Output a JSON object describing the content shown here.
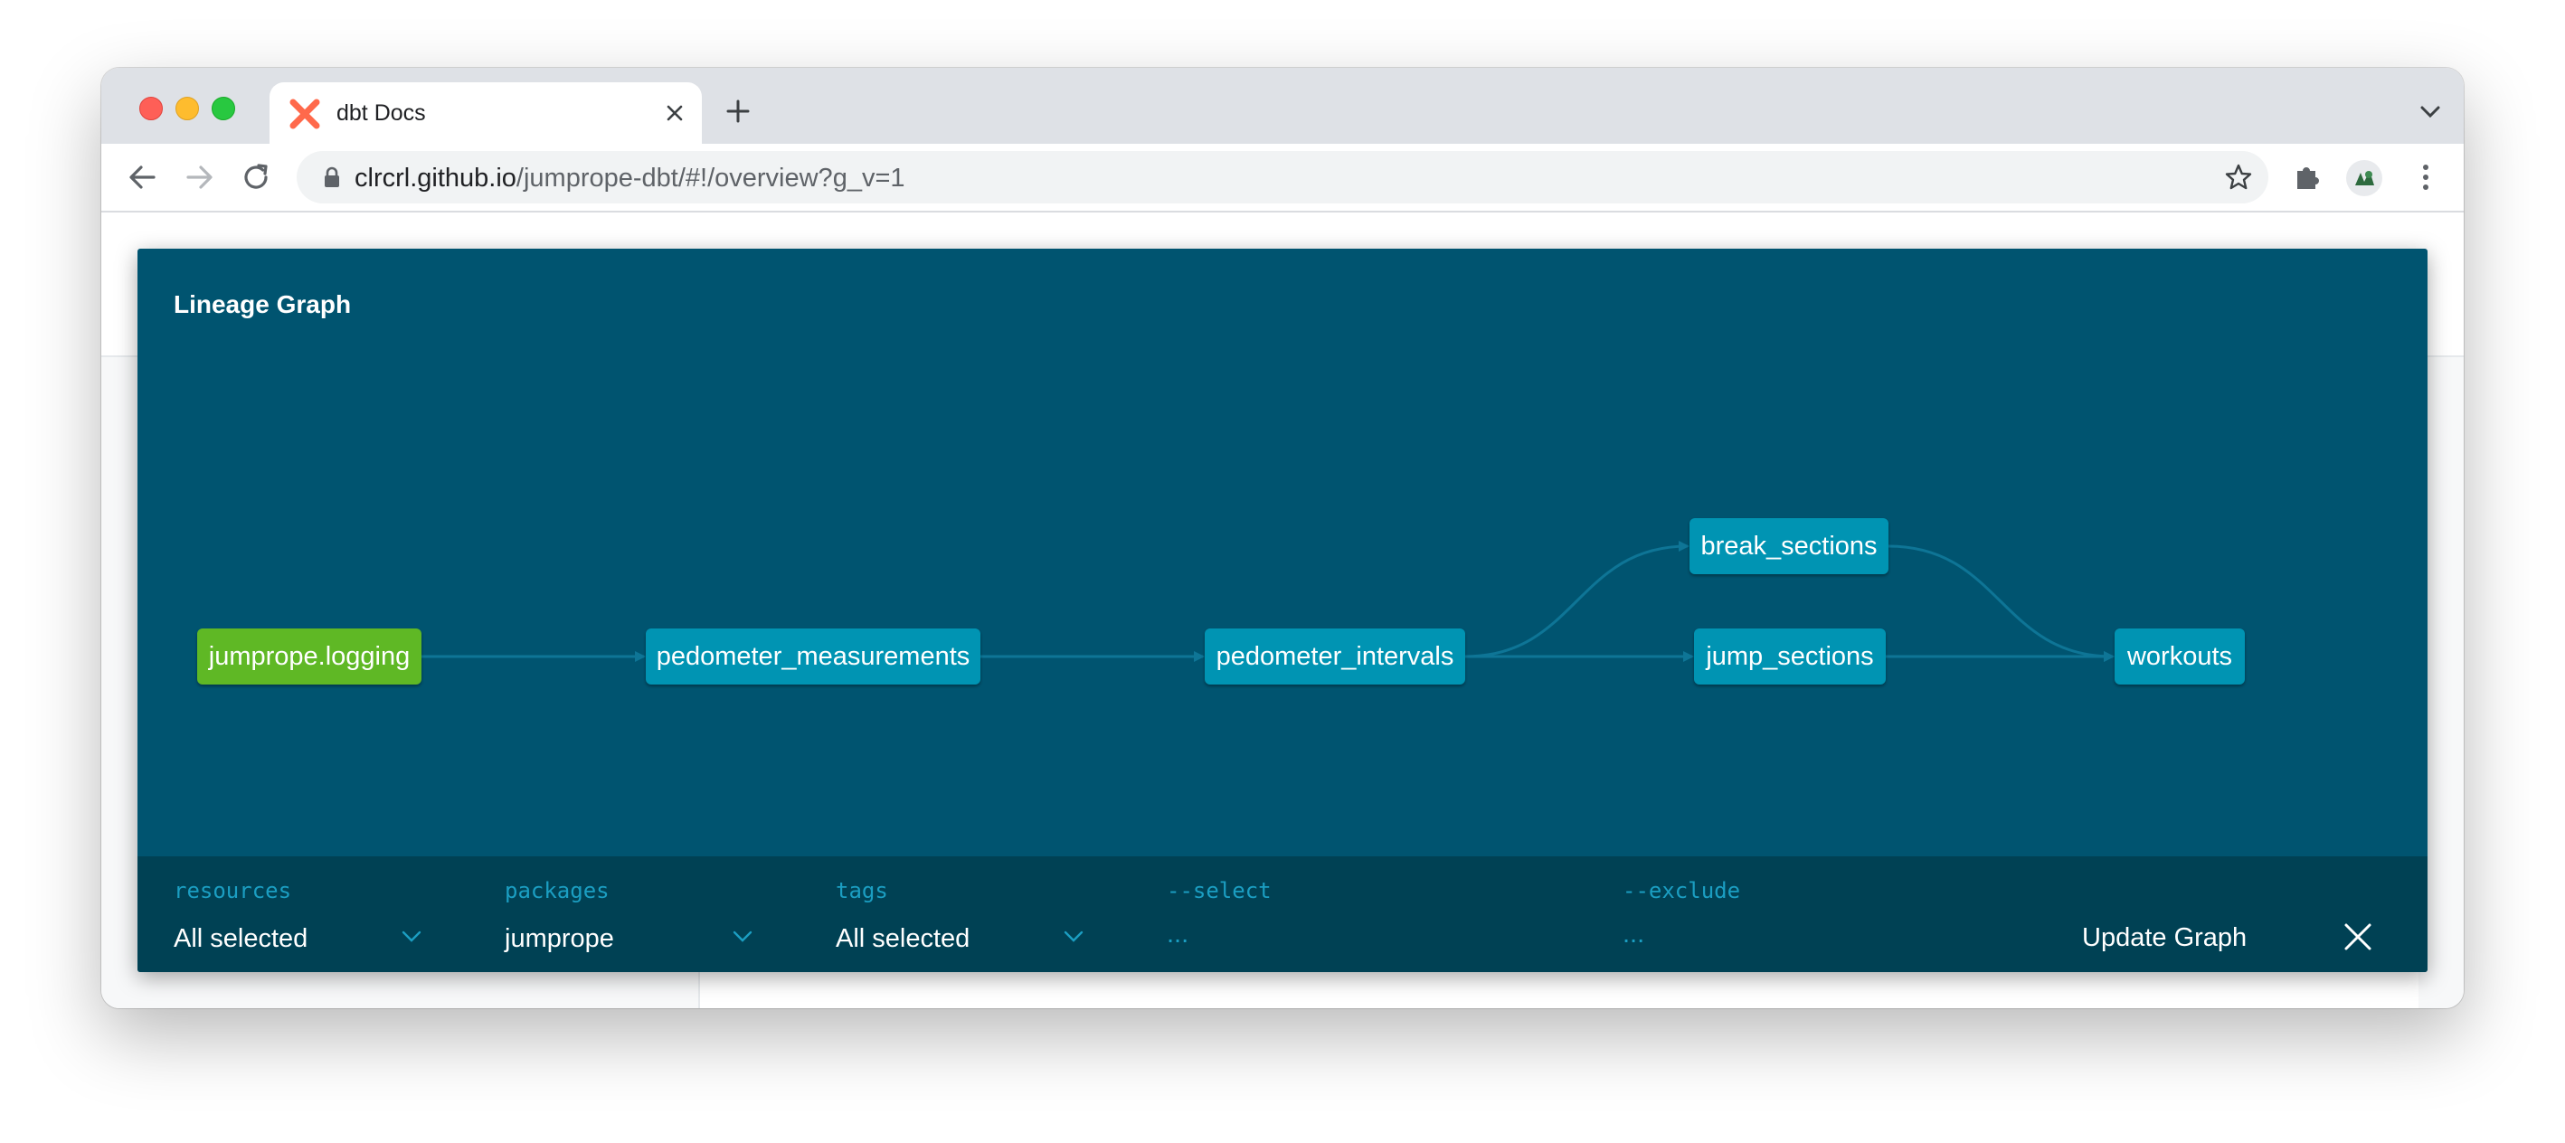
{
  "browser": {
    "tab_title": "dbt Docs",
    "url_host": "clrcrl.github.io",
    "url_path": "/jumprope-dbt/#!/overview?g_v=1"
  },
  "modal": {
    "title": "Lineage Graph"
  },
  "graph": {
    "nodes": [
      {
        "id": "jumprope.logging",
        "label": "jumprope.logging",
        "type": "source",
        "color": "#5fb825"
      },
      {
        "id": "pedometer_measurements",
        "label": "pedometer_measurements",
        "type": "model",
        "color": "#0094b3"
      },
      {
        "id": "pedometer_intervals",
        "label": "pedometer_intervals",
        "type": "model",
        "color": "#0094b3"
      },
      {
        "id": "break_sections",
        "label": "break_sections",
        "type": "model",
        "color": "#0094b3"
      },
      {
        "id": "jump_sections",
        "label": "jump_sections",
        "type": "model",
        "color": "#0094b3"
      },
      {
        "id": "workouts",
        "label": "workouts",
        "type": "model",
        "color": "#0094b3"
      }
    ],
    "edges": [
      [
        "jumprope.logging",
        "pedometer_measurements"
      ],
      [
        "pedometer_measurements",
        "pedometer_intervals"
      ],
      [
        "pedometer_intervals",
        "break_sections"
      ],
      [
        "pedometer_intervals",
        "jump_sections"
      ],
      [
        "break_sections",
        "workouts"
      ],
      [
        "jump_sections",
        "workouts"
      ]
    ]
  },
  "controls": {
    "resources": {
      "label": "resources",
      "value": "All selected"
    },
    "packages": {
      "label": "packages",
      "value": "jumprope"
    },
    "tags": {
      "label": "tags",
      "value": "All selected"
    },
    "select": {
      "label": "--select",
      "placeholder": "..."
    },
    "exclude": {
      "label": "--exclude",
      "placeholder": "..."
    },
    "update_button": "Update Graph"
  },
  "icons": {
    "favicon": "dbt-logo-icon",
    "back": "arrow-left-icon",
    "forward": "arrow-right-icon",
    "reload": "reload-icon",
    "lock": "lock-icon",
    "bookmark": "star-icon",
    "extensions": "puzzle-icon",
    "menu": "kebab-icon",
    "close": "close-icon"
  },
  "colors": {
    "modal_bg": "#005470",
    "controls_bg": "#004154",
    "model_node": "#0094b3",
    "source_node": "#5fb825",
    "control_label": "#1b9ec2"
  }
}
